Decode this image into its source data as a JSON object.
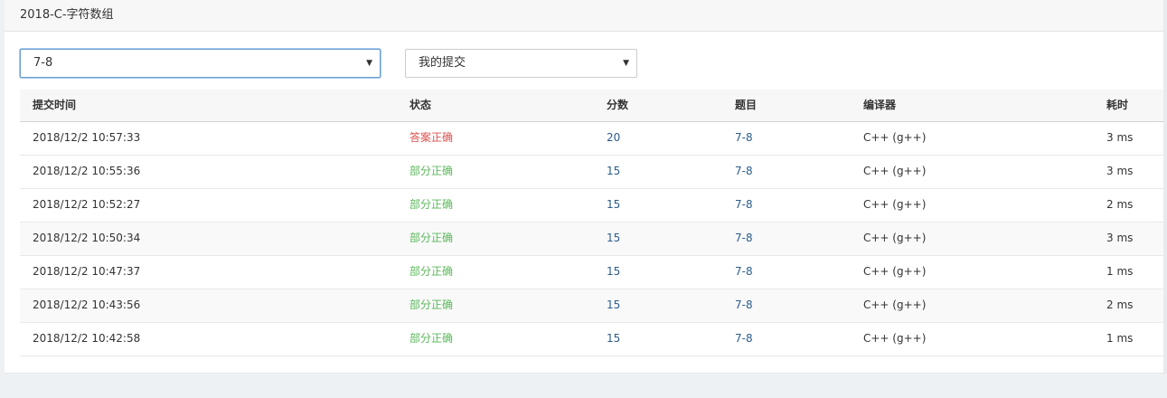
{
  "panel": {
    "title": "2018-C-字符数组"
  },
  "filters": {
    "problem_select": {
      "value": "7-8"
    },
    "scope_select": {
      "value": "我的提交"
    }
  },
  "table": {
    "headers": {
      "time": "提交时间",
      "status": "状态",
      "score": "分数",
      "problem": "题目",
      "compiler": "编译器",
      "cost": "耗时"
    },
    "rows": [
      {
        "time": "2018/12/2 10:57:33",
        "status": "答案正确",
        "status_type": "accepted",
        "score": "20",
        "problem": "7-8",
        "compiler": "C++ (g++)",
        "cost": "3 ms"
      },
      {
        "time": "2018/12/2 10:55:36",
        "status": "部分正确",
        "status_type": "partial",
        "score": "15",
        "problem": "7-8",
        "compiler": "C++ (g++)",
        "cost": "3 ms"
      },
      {
        "time": "2018/12/2 10:52:27",
        "status": "部分正确",
        "status_type": "partial",
        "score": "15",
        "problem": "7-8",
        "compiler": "C++ (g++)",
        "cost": "2 ms"
      },
      {
        "time": "2018/12/2 10:50:34",
        "status": "部分正确",
        "status_type": "partial",
        "score": "15",
        "problem": "7-8",
        "compiler": "C++ (g++)",
        "cost": "3 ms"
      },
      {
        "time": "2018/12/2 10:47:37",
        "status": "部分正确",
        "status_type": "partial",
        "score": "15",
        "problem": "7-8",
        "compiler": "C++ (g++)",
        "cost": "1 ms"
      },
      {
        "time": "2018/12/2 10:43:56",
        "status": "部分正确",
        "status_type": "partial",
        "score": "15",
        "problem": "7-8",
        "compiler": "C++ (g++)",
        "cost": "2 ms"
      },
      {
        "time": "2018/12/2 10:42:58",
        "status": "部分正确",
        "status_type": "partial",
        "score": "15",
        "problem": "7-8",
        "compiler": "C++ (g++)",
        "cost": "1 ms"
      }
    ]
  },
  "colors": {
    "accepted": "#d9534f",
    "partial": "#5cb85c",
    "link": "#2c5d8c"
  }
}
